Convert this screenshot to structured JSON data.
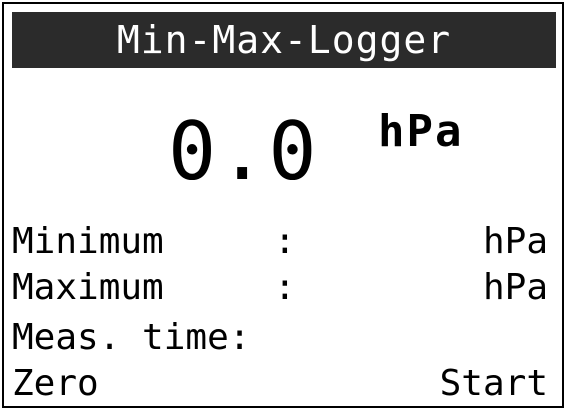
{
  "screen": {
    "title": "Min-Max-Logger"
  },
  "reading": {
    "value": "0.0",
    "unit": "hPa"
  },
  "rows": {
    "minimum": {
      "label": "Minimum",
      "separator": ":",
      "unit": "hPa"
    },
    "maximum": {
      "label": "Maximum",
      "separator": ":",
      "unit": "hPa"
    },
    "meas_time": {
      "label": "Meas. time:"
    }
  },
  "softkeys": {
    "left": "Zero",
    "right": "Start"
  },
  "colors": {
    "title_bar_bg": "#2b2b2b",
    "title_bar_text": "#ffffff",
    "background": "#ffffff",
    "text": "#000000"
  }
}
